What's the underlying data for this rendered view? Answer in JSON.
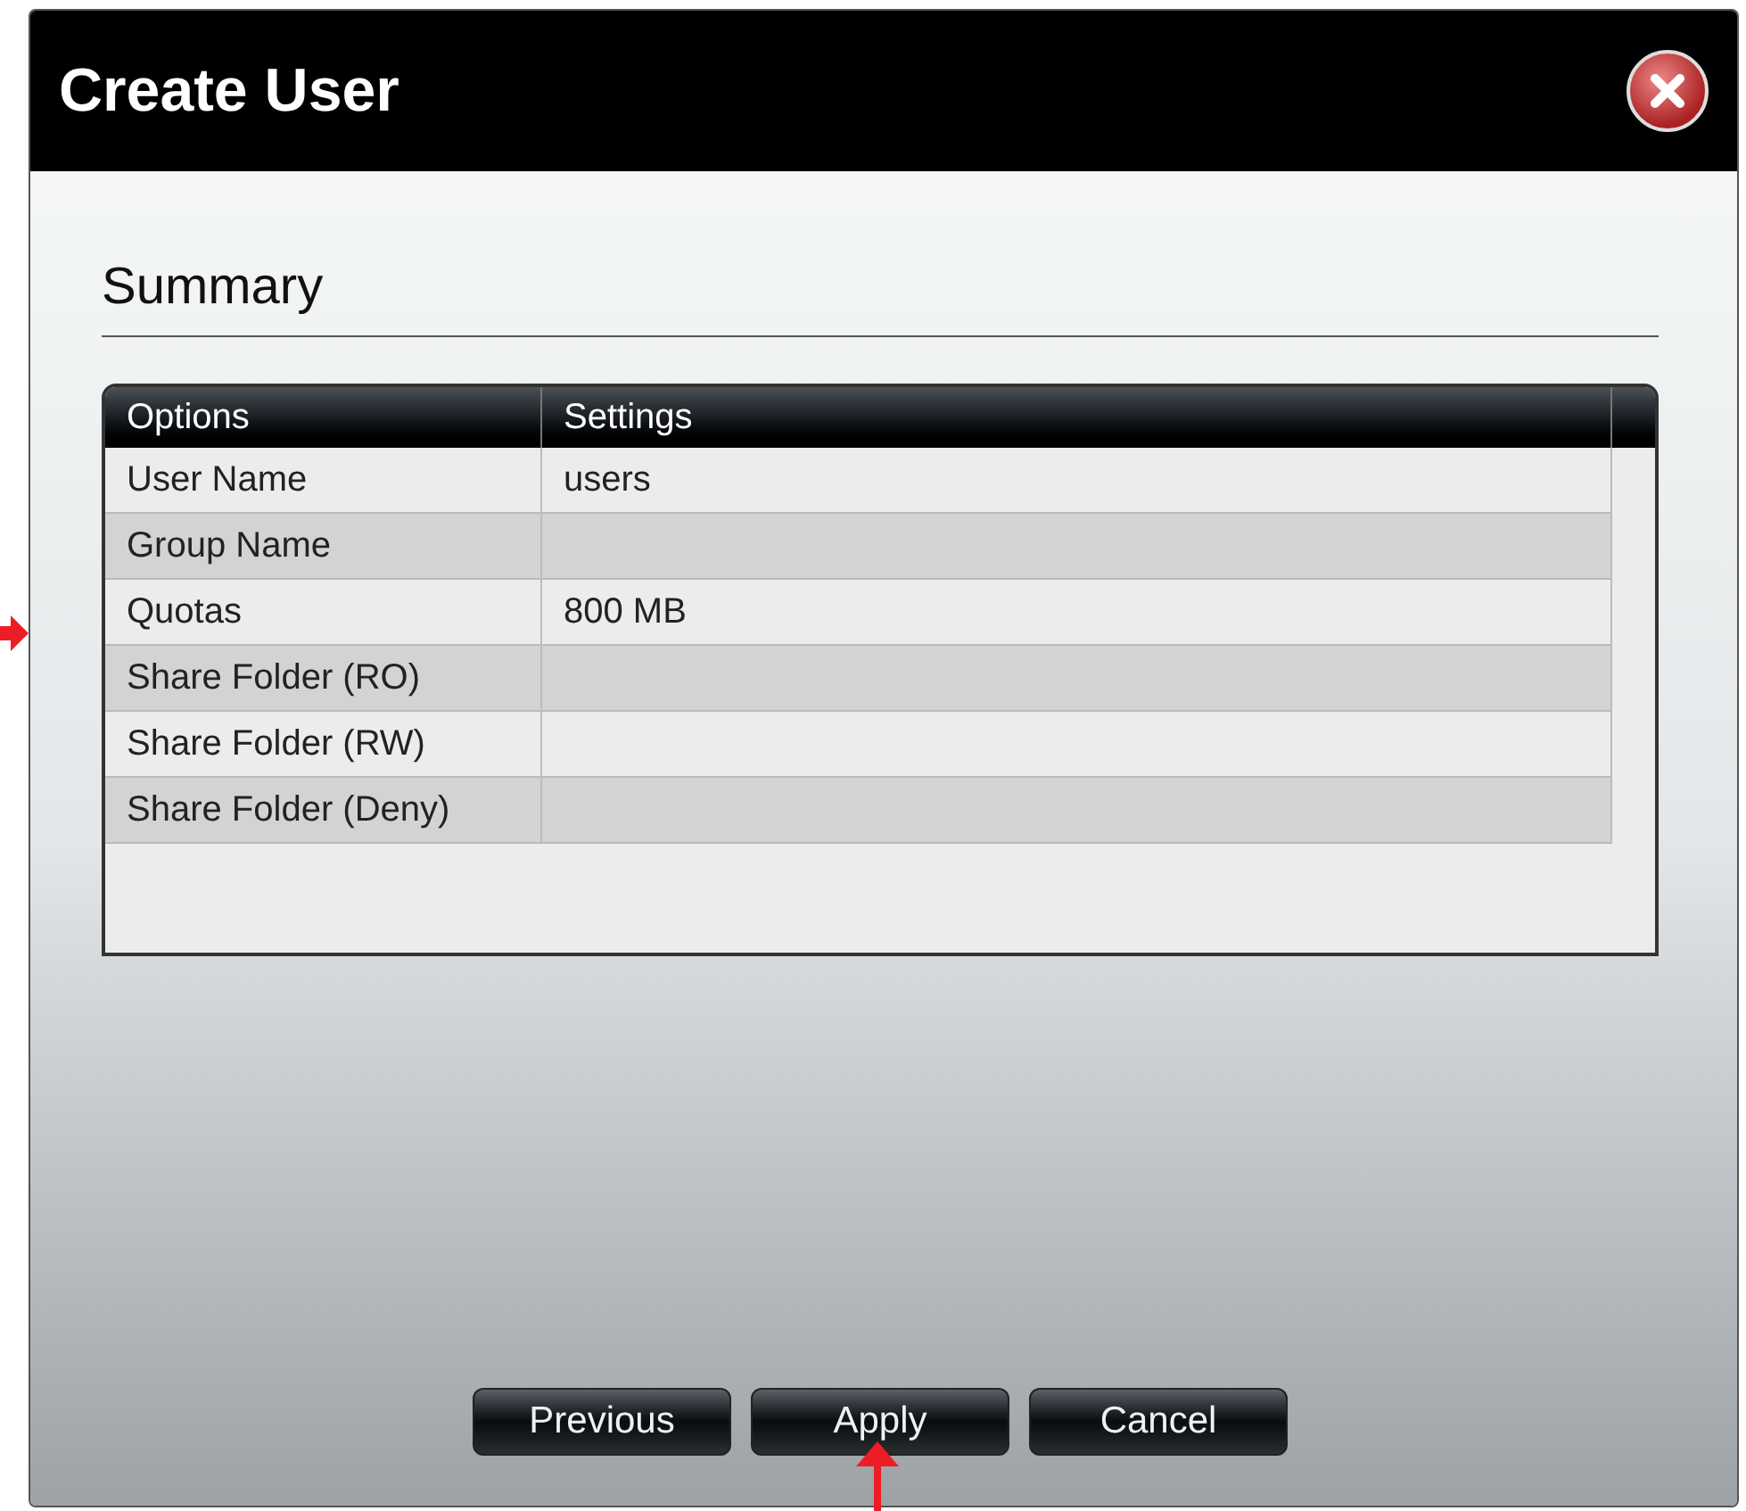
{
  "window": {
    "title": "Create User"
  },
  "section": {
    "title": "Summary"
  },
  "table": {
    "columns": [
      "Options",
      "Settings"
    ],
    "rows": [
      {
        "option": "User Name",
        "setting": "users"
      },
      {
        "option": "Group Name"
      },
      {
        "option": "Quotas",
        "setting": "800 MB"
      },
      {
        "option": "Share Folder (RO)"
      },
      {
        "option": "Share Folder (RW)"
      },
      {
        "option": "Share Folder (Deny)"
      }
    ]
  },
  "buttons": [
    "Previous",
    "Apply",
    "Cancel"
  ]
}
